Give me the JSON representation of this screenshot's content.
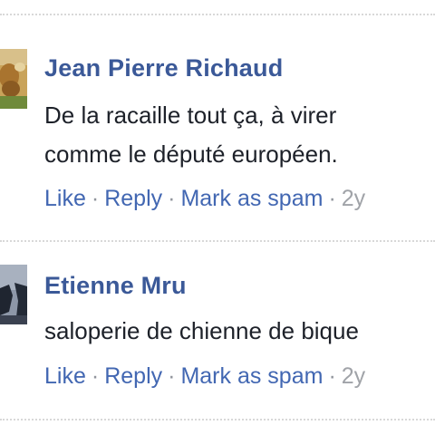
{
  "comments": [
    {
      "author": "Jean Pierre Richaud",
      "text_line1": "De la racaille tout ça, à virer",
      "text_line2": "comme le député européen.",
      "actions": {
        "like": "Like",
        "reply": "Reply",
        "spam": "Mark as spam",
        "separator": "·",
        "time": "2y"
      },
      "avatar": "profile-photo"
    },
    {
      "author": "Etienne Mru",
      "text_line1": "saloperie de chienne de bique",
      "actions": {
        "like": "Like",
        "reply": "Reply",
        "spam": "Mark as spam",
        "separator": "·",
        "time": "2y"
      },
      "avatar": "profile-photo"
    }
  ],
  "colors": {
    "author": "#3b5998",
    "link": "#4267b2",
    "text": "#1d2129",
    "meta": "#90949c"
  }
}
